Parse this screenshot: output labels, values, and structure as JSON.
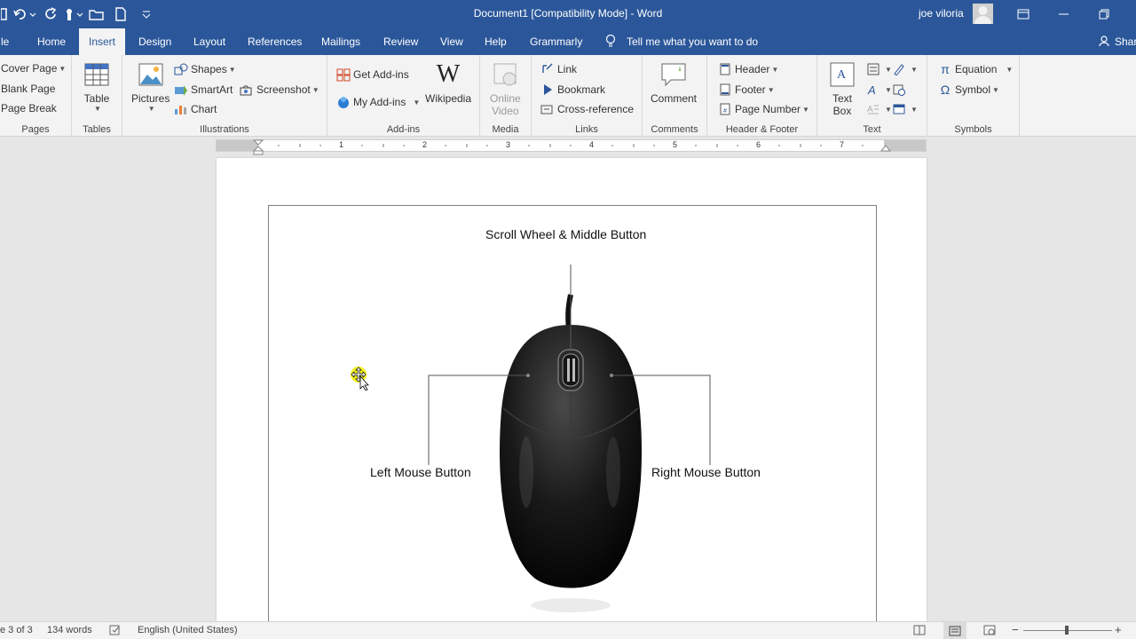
{
  "title_bar": {
    "doc_title": "Document1 [Compatibility Mode]  -  Word",
    "user_name": "joe viloria"
  },
  "tabs": [
    {
      "label": "le"
    },
    {
      "label": "Home"
    },
    {
      "label": "Insert"
    },
    {
      "label": "Design"
    },
    {
      "label": "Layout"
    },
    {
      "label": "References"
    },
    {
      "label": "Mailings"
    },
    {
      "label": "Review"
    },
    {
      "label": "View"
    },
    {
      "label": "Help"
    },
    {
      "label": "Grammarly"
    }
  ],
  "tell_me": "Tell me what you want to do",
  "share": "Shar",
  "ribbon": {
    "pages": {
      "cover_page": "Cover Page",
      "blank_page": "Blank Page",
      "page_break": "Page Break",
      "label": "Pages"
    },
    "tables": {
      "table": "Table",
      "label": "Tables"
    },
    "illustrations": {
      "pictures": "Pictures",
      "shapes": "Shapes",
      "smartart": "SmartArt",
      "chart": "Chart",
      "screenshot": "Screenshot",
      "label": "Illustrations"
    },
    "addins": {
      "get_addins": "Get Add-ins",
      "my_addins": "My Add-ins",
      "wikipedia": "Wikipedia",
      "label": "Add-ins"
    },
    "media": {
      "online_video_1": "Online",
      "online_video_2": "Video",
      "label": "Media"
    },
    "links": {
      "link": "Link",
      "bookmark": "Bookmark",
      "cross_reference": "Cross-reference",
      "label": "Links"
    },
    "comments": {
      "comment": "Comment",
      "label": "Comments"
    },
    "header_footer": {
      "header": "Header",
      "footer": "Footer",
      "page_number": "Page Number",
      "label": "Header & Footer"
    },
    "text": {
      "text_box_1": "Text",
      "text_box_2": "Box",
      "label": "Text"
    },
    "symbols": {
      "equation": "Equation",
      "symbol": "Symbol",
      "label": "Symbols"
    }
  },
  "ruler": {
    "numbers": [
      "1",
      "2",
      "3",
      "4",
      "5",
      "6",
      "7"
    ]
  },
  "figure": {
    "scroll_label": "Scroll Wheel & Middle Button",
    "left_label": "Left Mouse Button",
    "right_label": "Right Mouse Button"
  },
  "status": {
    "page": "e 3 of 3",
    "words": "134 words",
    "language": "English (United States)"
  },
  "colors": {
    "title_bar": "#2b579a",
    "ribbon": "#f3f3f3",
    "canvas": "#e6e6e6"
  }
}
